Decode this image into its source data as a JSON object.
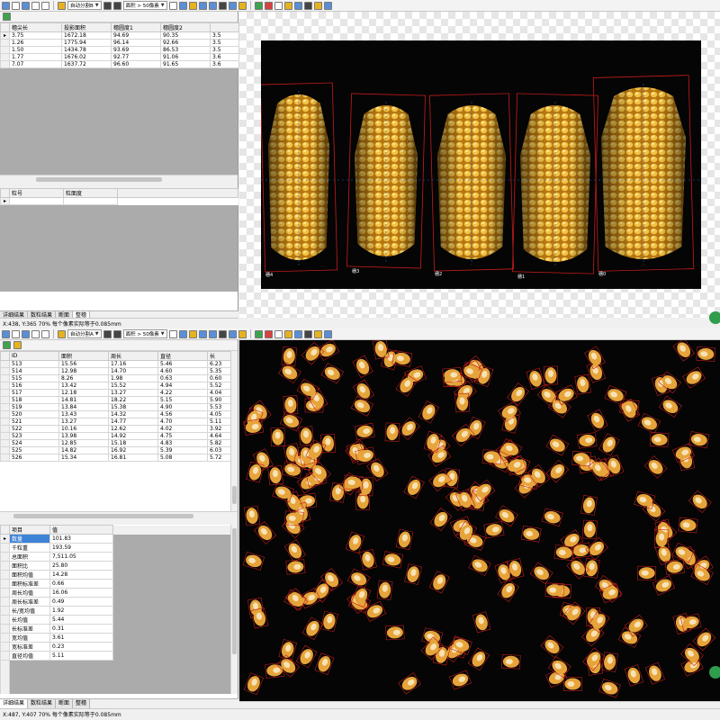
{
  "top": {
    "toolbar": {
      "combo1": "自动分割B",
      "combo2": "面积 > 50像素"
    },
    "table": {
      "columns": [
        "",
        "穗尖长",
        "投影面积",
        "穗圆度1",
        "穗圆度2",
        ""
      ],
      "rows": [
        {
          "cells": [
            "3.75",
            "1672.18",
            "94.69",
            "90.35",
            "3.5"
          ]
        },
        {
          "cells": [
            "1.26",
            "1775.94",
            "96.14",
            "92.66",
            "3.5"
          ]
        },
        {
          "cells": [
            "1.50",
            "1434.78",
            "93.69",
            "86.53",
            "3.5"
          ]
        },
        {
          "cells": [
            "1.77",
            "1676.02",
            "92.77",
            "91.06",
            "3.6"
          ]
        },
        {
          "cells": [
            "7.07",
            "1637.72",
            "96.60",
            "91.65",
            "3.6"
          ]
        }
      ]
    },
    "table2": {
      "columns": [
        "粒号",
        "粒面度"
      ]
    },
    "tabs": [
      "详细结果",
      "数粒结果",
      "断面",
      "整穗"
    ],
    "ears": [
      {
        "label": "穗4"
      },
      {
        "label": "穗3"
      },
      {
        "label": "穗2"
      },
      {
        "label": "穗1"
      },
      {
        "label": "穗0"
      }
    ]
  },
  "bottom": {
    "status_top": "X:438, Y:365   70%   每个像素实际等于0.085mm",
    "toolbar": {
      "combo1": "自动分割A",
      "combo2": "面积 > 50像素"
    },
    "table": {
      "columns": [
        "ID",
        "面积",
        "周长",
        "直径",
        "长"
      ],
      "rows": [
        {
          "cells": [
            "513",
            "15.56",
            "17.16",
            "5.46",
            "6.23"
          ]
        },
        {
          "cells": [
            "514",
            "12.98",
            "14.70",
            "4.60",
            "5.35"
          ]
        },
        {
          "cells": [
            "515",
            "8.26",
            "1.98",
            "0.63",
            "0.60"
          ]
        },
        {
          "cells": [
            "516",
            "13.42",
            "15.52",
            "4.94",
            "5.52"
          ]
        },
        {
          "cells": [
            "517",
            "12.18",
            "13.27",
            "4.22",
            "4.04"
          ]
        },
        {
          "cells": [
            "518",
            "14.81",
            "18.22",
            "5.15",
            "5.90"
          ]
        },
        {
          "cells": [
            "519",
            "13.84",
            "15.38",
            "4.90",
            "5.53"
          ]
        },
        {
          "cells": [
            "520",
            "13.43",
            "14.32",
            "4.56",
            "4.05"
          ]
        },
        {
          "cells": [
            "521",
            "13.27",
            "14.77",
            "4.70",
            "5.11"
          ]
        },
        {
          "cells": [
            "522",
            "10.16",
            "12.62",
            "4.02",
            "3.92"
          ]
        },
        {
          "cells": [
            "523",
            "13.98",
            "14.92",
            "4.75",
            "4.64"
          ]
        },
        {
          "cells": [
            "524",
            "12.85",
            "15.18",
            "4.83",
            "5.82"
          ]
        },
        {
          "cells": [
            "525",
            "14.82",
            "16.92",
            "5.39",
            "6.03"
          ]
        },
        {
          "cells": [
            "526",
            "15.34",
            "16.81",
            "5.08",
            "5.72"
          ]
        }
      ]
    },
    "stats": {
      "columns": [
        "项目",
        "值"
      ],
      "rows": [
        {
          "k": "数量",
          "v": "101.83"
        },
        {
          "k": "千粒重",
          "v": "193.59"
        },
        {
          "k": "总面积",
          "v": "7,511.05"
        },
        {
          "k": "面积比",
          "v": "25.80"
        },
        {
          "k": "面积均值",
          "v": "14.28"
        },
        {
          "k": "面积标准差",
          "v": "0.66"
        },
        {
          "k": "周长均值",
          "v": "16.06"
        },
        {
          "k": "周长标准差",
          "v": "0.49"
        },
        {
          "k": "长/宽均值",
          "v": "1.92"
        },
        {
          "k": "长均值",
          "v": "5.44"
        },
        {
          "k": "长标准差",
          "v": "0.31"
        },
        {
          "k": "宽均值",
          "v": "3.61"
        },
        {
          "k": "宽标准差",
          "v": "0.23"
        },
        {
          "k": "直径均值",
          "v": "5.11"
        }
      ]
    },
    "tabs": [
      "详细结果",
      "数粒结果",
      "断面",
      "整穗"
    ],
    "status": "X:487, Y:407   70%   每个像素实际等于0.085mm",
    "colors": {
      "selection": "#3d83d8",
      "box": "#c41c1c",
      "kernel": "#e6a43a"
    }
  }
}
